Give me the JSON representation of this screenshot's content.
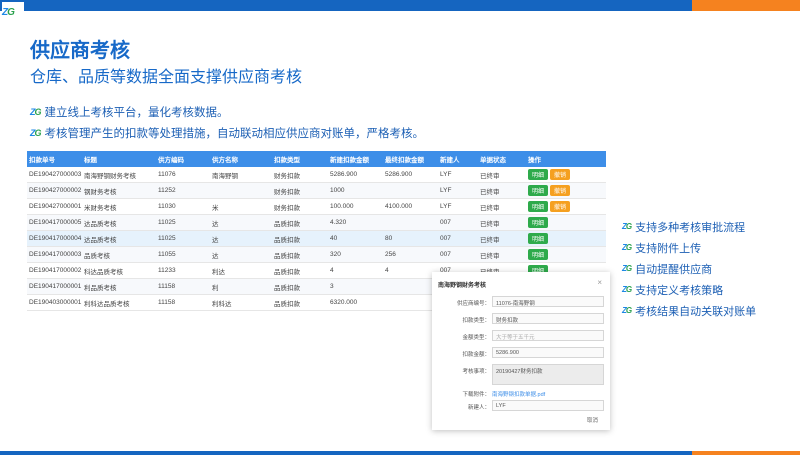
{
  "brand": {
    "logo_text_a": "Z",
    "logo_text_b": "G",
    "blue": "#1565c0",
    "orange": "#f5821f"
  },
  "slide": {
    "title": "供应商考核",
    "subtitle": "仓库、品质等数据全面支撑供应商考核",
    "bullets": [
      "建立线上考核平台，量化考核数据。",
      "考核管理产生的扣款等处理措施，自动联动相应供应商对账单，严格考核。"
    ]
  },
  "table": {
    "headers": [
      "扣款单号",
      "标题",
      "供方编码",
      "供方名称",
      "扣款类型",
      "新建扣款金额",
      "最终扣款金额",
      "新建人",
      "单据状态",
      "操作"
    ],
    "rows": [
      {
        "no": "DE190427000003",
        "title": "南海野钢财务考核",
        "code": "11076",
        "name": "南海野钢",
        "type": "财务扣款",
        "amt1": "5286.900",
        "amt2": "5286.900",
        "user": "LYF",
        "status": "已终审",
        "actions": [
          "明细",
          "撤销"
        ]
      },
      {
        "no": "DE190427000002",
        "title": "钢财务考核",
        "code": "11252",
        "name": "",
        "type": "财务扣款",
        "amt1": "1000",
        "amt2": "",
        "user": "LYF",
        "status": "已终审",
        "actions": [
          "明细",
          "撤销"
        ]
      },
      {
        "no": "DE190427000001",
        "title": "米财务考核",
        "code": "11030",
        "name": "米",
        "type": "财务扣款",
        "amt1": "100.000",
        "amt2": "4100.000",
        "user": "LYF",
        "status": "已终审",
        "actions": [
          "明细",
          "撤销"
        ]
      },
      {
        "no": "DE190417000005",
        "title": "达品质考核",
        "code": "11025",
        "name": "达",
        "type": "品质扣款",
        "amt1": "4.320",
        "amt2": "",
        "user": "007",
        "status": "已终审",
        "actions": [
          "明细"
        ]
      },
      {
        "no": "DE190417000004",
        "title": "达品质考核",
        "code": "11025",
        "name": "达",
        "type": "品质扣款",
        "amt1": "40",
        "amt2": "80",
        "user": "007",
        "status": "已终审",
        "actions": [
          "明细"
        ]
      },
      {
        "no": "DE190417000003",
        "title": "品质考核",
        "code": "11055",
        "name": "达",
        "type": "品质扣款",
        "amt1": "320",
        "amt2": "256",
        "user": "007",
        "status": "已终审",
        "actions": [
          "明细"
        ]
      },
      {
        "no": "DE190417000002",
        "title": "科达品质考核",
        "code": "11233",
        "name": "利达",
        "type": "品质扣款",
        "amt1": "4",
        "amt2": "4",
        "user": "007",
        "status": "已终审",
        "actions": [
          "明细"
        ]
      },
      {
        "no": "DE190417000001",
        "title": "利品质考核",
        "code": "11158",
        "name": "利",
        "type": "品质扣款",
        "amt1": "3",
        "amt2": "",
        "user": "",
        "status": "",
        "actions": []
      },
      {
        "no": "DE190403000001",
        "title": "利科达品质考核",
        "code": "11158",
        "name": "利科达",
        "type": "品质扣款",
        "amt1": "6320.000",
        "amt2": "",
        "user": "",
        "status": "",
        "actions": []
      }
    ]
  },
  "features": [
    "支持多种考核审批流程",
    "支持附件上传",
    "自动提醒供应商",
    "支持定义考核策略",
    "考核结果自动关联对账单"
  ],
  "modal": {
    "title": "南海野钢财务考核",
    "close": "×",
    "fields": [
      {
        "label": "供应商编号：",
        "value": "11076-南海野钢",
        "kind": "field"
      },
      {
        "label": "扣款类型：",
        "value": "财务扣款",
        "kind": "field"
      },
      {
        "label": "金额类型：",
        "value": "大于等于五千元",
        "kind": "placeholder"
      },
      {
        "label": "扣款金额：",
        "value": "5286.900",
        "kind": "field"
      },
      {
        "label": "考核事项：",
        "value": "20190427财务扣款",
        "kind": "area"
      },
      {
        "label": "下载附件：",
        "value": "南海野钢扣款单据.pdf",
        "kind": "link"
      },
      {
        "label": "新建人：",
        "value": "LYF",
        "kind": "field"
      }
    ],
    "cancel": "取消"
  }
}
